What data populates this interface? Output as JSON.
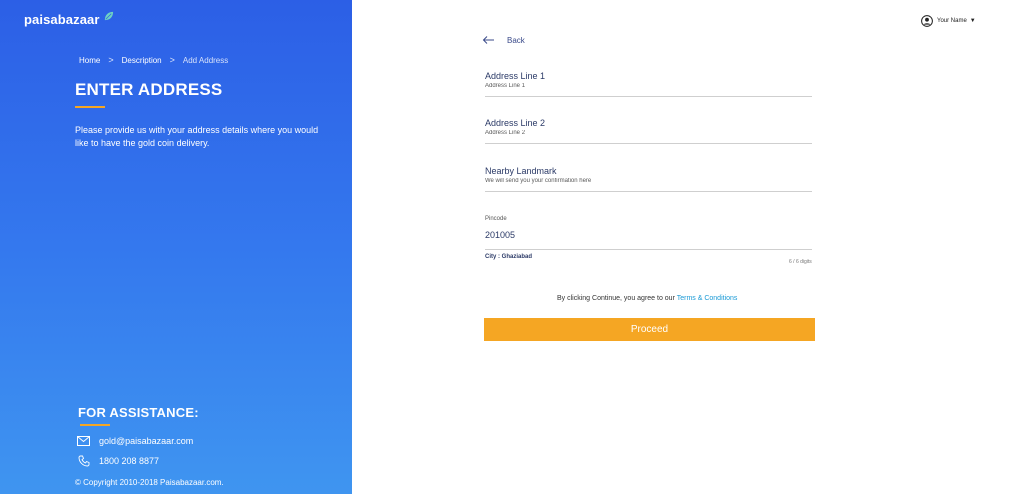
{
  "brand": {
    "logo_text": "paisabazaar",
    "accent": "#f5a623",
    "gradient_top": "#2c5fe6",
    "gradient_bottom": "#3f95f0"
  },
  "breadcrumb": {
    "items": [
      "Home",
      "Description",
      "Add Address"
    ],
    "separator": ">"
  },
  "page": {
    "title": "ENTER ADDRESS",
    "intro": "Please provide us with your address details where you would like to have the gold coin delivery."
  },
  "assistance": {
    "title": "FOR ASSISTANCE:",
    "email": "gold@paisabazaar.com",
    "phone": "1800 208 8877",
    "email_icon": "envelope-icon",
    "phone_icon": "phone-icon"
  },
  "copyright": "© Copyright 2010-2018 Paisabazaar.com.",
  "user": {
    "name": "Your Name",
    "icon": "user-avatar-icon"
  },
  "back": {
    "label": "Back"
  },
  "form": {
    "address1": {
      "label": "Address Line 1",
      "placeholder": "Address Line 1",
      "value": ""
    },
    "address2": {
      "label": "Address Line 2",
      "placeholder": "Address Line 2",
      "value": ""
    },
    "landmark": {
      "label": "Nearby Landmark",
      "placeholder": "We will send you your confirmation here",
      "value": ""
    },
    "pincode": {
      "label": "Pincode",
      "value": "201005",
      "counter": "6 / 6 digits"
    },
    "city": "City : Ghaziabad"
  },
  "terms": {
    "prefix": "By clicking Continue, you agree to our ",
    "link": "Terms & Conditions"
  },
  "proceed": {
    "label": "Proceed"
  }
}
